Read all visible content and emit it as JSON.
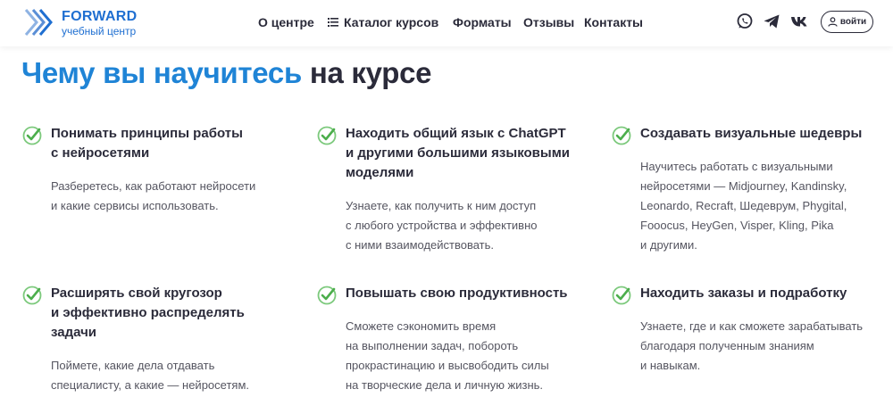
{
  "header": {
    "logo": {
      "title": "FORWARD",
      "subtitle": "учебный центр"
    },
    "nav": {
      "about": "О центре",
      "catalog": "Каталог курсов",
      "formats": "Форматы",
      "reviews": "Отзывы",
      "contacts": "Контакты"
    },
    "socials": [
      "whatsapp-icon",
      "telegram-icon",
      "vk-icon"
    ],
    "login_label": "войти"
  },
  "main": {
    "title_accent": "Чему вы научитесь",
    "title_rest": "на курсе",
    "features": [
      {
        "title": [
          "Понимать принципы работы",
          "с нейросетями"
        ],
        "desc": [
          "Разберетесь, как работают нейросети",
          "и какие сервисы использовать."
        ]
      },
      {
        "title": [
          "Находить общий язык с ChatGPT",
          "и другими большими языковыми",
          "моделями"
        ],
        "desc": [
          "Узнаете, как получить к ним доступ",
          "с любого устройства и эффективно",
          "с ними взаимодействовать."
        ]
      },
      {
        "title": [
          "Создавать визуальные шедевры"
        ],
        "desc": [
          "Научитесь работать с визуальными",
          "нейросетями — Midjourney, Kandinsky,",
          "Leonardo, Recraft, Шедеврум, Phygital,",
          "Fooocus, HeyGen, Visper, Kling, Pika",
          "и другими."
        ]
      },
      {
        "title": [
          "Расширять свой кругозор",
          "и эффективно распределять",
          "задачи"
        ],
        "desc": [
          "Поймете, какие дела отдавать",
          "специалисту, а какие — нейросетям."
        ]
      },
      {
        "title": [
          "Повышать свою продуктивность"
        ],
        "desc": [
          "Сможете сэкономить время",
          "на выполнении задач, побороть",
          "прокрастинацию и высвободить силы",
          "на творческие дела и личную жизнь."
        ]
      },
      {
        "title": [
          "Находить заказы и подработку"
        ],
        "desc": [
          "Узнаете, где и как сможете зарабатывать",
          "благодаря полученным знаниям",
          "и навыкам."
        ]
      }
    ]
  },
  "colors": {
    "accent": "#1f84d6",
    "brand": "#1f6fd1",
    "check": "#5cb85c",
    "text": "#2b2b3a"
  }
}
